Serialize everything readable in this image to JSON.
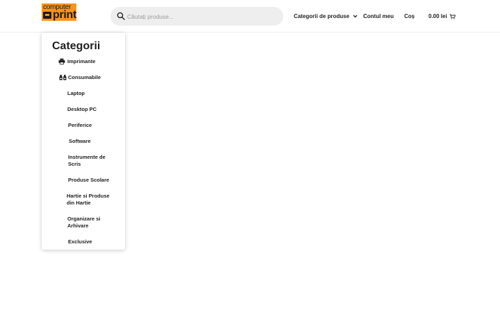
{
  "header": {
    "logo": {
      "line1": "computer",
      "line2": "print"
    },
    "search": {
      "placeholder": "Căutați produse..."
    },
    "nav": {
      "categories_label": "Categorii de produse",
      "account_label": "Contul meu",
      "cart_label": "Coș",
      "cart_total": "0.00 lei"
    }
  },
  "dropdown": {
    "title": "Categorii",
    "items": [
      {
        "label": "Imprimante",
        "icon": "printer-icon"
      },
      {
        "label": "Consumabile",
        "icon": "ink-cartridge-icon"
      },
      {
        "label": "Laptop"
      },
      {
        "label": "Desktop PC"
      },
      {
        "label": "Periferice"
      },
      {
        "label": "Software"
      },
      {
        "label": "Instrumente de Scris"
      },
      {
        "label": "Produse Scolare"
      },
      {
        "label": "Hartie si Produse din Hartie"
      },
      {
        "label": "Organizare si Arhivare"
      },
      {
        "label": "Exclusive"
      }
    ]
  },
  "colors": {
    "brand_orange": "#f7941d",
    "search_bg": "#eeeeee",
    "text": "#1f1f1f"
  }
}
